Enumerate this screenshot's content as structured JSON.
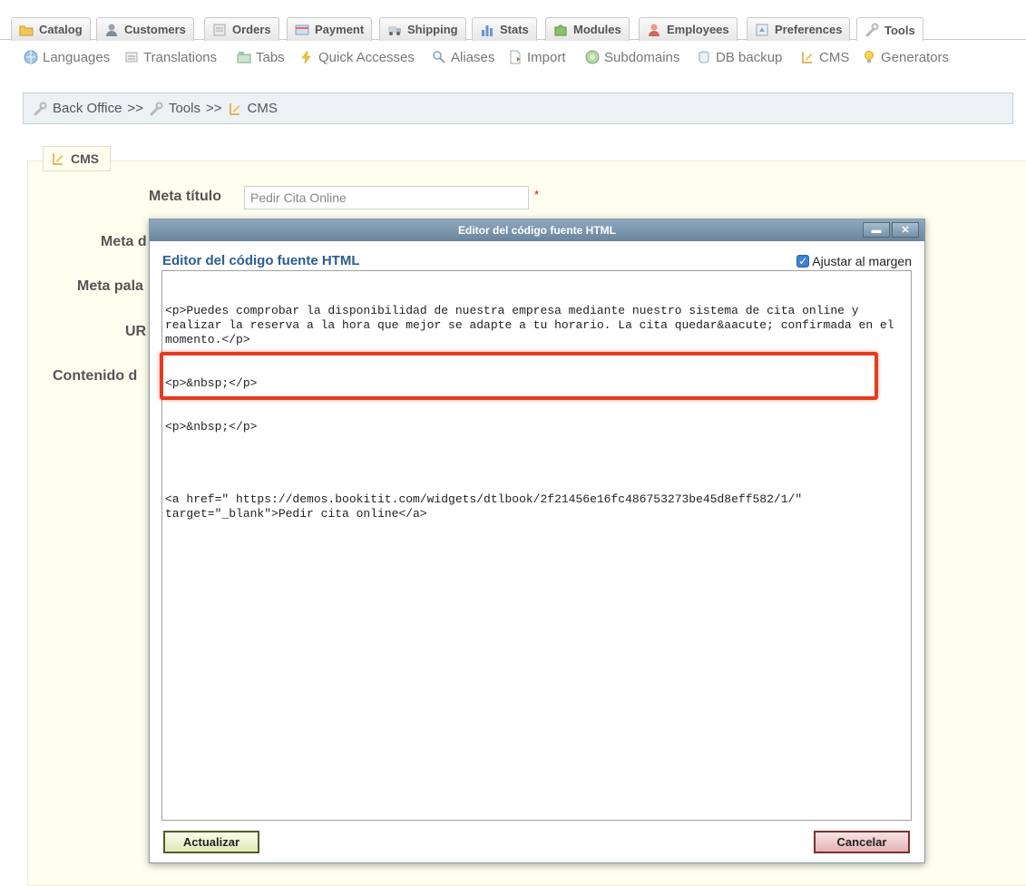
{
  "tabs": [
    {
      "label": "Catalog",
      "icon": "folder-icon"
    },
    {
      "label": "Customers",
      "icon": "user-icon"
    },
    {
      "label": "Orders",
      "icon": "orders-icon"
    },
    {
      "label": "Payment",
      "icon": "payment-icon"
    },
    {
      "label": "Shipping",
      "icon": "truck-icon"
    },
    {
      "label": "Stats",
      "icon": "bar-chart-icon"
    },
    {
      "label": "Modules",
      "icon": "puzzle-icon"
    },
    {
      "label": "Employees",
      "icon": "employee-icon"
    },
    {
      "label": "Preferences",
      "icon": "preferences-icon"
    },
    {
      "label": "Tools",
      "icon": "wrench-icon"
    }
  ],
  "subnav": [
    {
      "label": "Languages",
      "icon": "globe-icon"
    },
    {
      "label": "Translations",
      "icon": "translations-icon"
    },
    {
      "label": "Tabs",
      "icon": "tabs-icon"
    },
    {
      "label": "Quick Accesses",
      "icon": "lightning-icon"
    },
    {
      "label": "Aliases",
      "icon": "magnifier-icon"
    },
    {
      "label": "Import",
      "icon": "import-icon"
    },
    {
      "label": "Subdomains",
      "icon": "subdomains-icon"
    },
    {
      "label": "DB backup",
      "icon": "database-icon"
    },
    {
      "label": "CMS",
      "icon": "cms-icon"
    },
    {
      "label": "Generators",
      "icon": "bulb-icon"
    }
  ],
  "breadcrumb": {
    "root": "Back Office",
    "sep": ">>",
    "tools": "Tools",
    "cms": "CMS"
  },
  "form": {
    "legend": "CMS",
    "meta_title_label": "Meta título",
    "meta_title_value": "Pedir Cita Online",
    "required_mark": "*",
    "meta_desc_label": "Meta d",
    "meta_keywords_label": "Meta pala",
    "url_label": "UR",
    "content_label": "Contenido d"
  },
  "modal": {
    "title": "Editor del código fuente HTML",
    "heading": "Editor del código fuente HTML",
    "minimize": "▬",
    "close": "✕",
    "wrap_label": "Ajustar al margen",
    "code_lines": [
      "<p>Puedes comprobar la disponibilidad de nuestra empresa mediante nuestro sistema de cita online y realizar la reserva a la hora que mejor se adapte a tu horario. La cita quedar&aacute; confirmada en el momento.</p>",
      "<p>&nbsp;</p>",
      "<p>&nbsp;</p>",
      "",
      "<a href=\" https://demos.bookitit.com/widgets/dtlbook/2f21456e16fc486753273be45d8eff582/1/\" target=\"_blank\">Pedir cita online</a>"
    ],
    "update_label": "Actualizar",
    "cancel_label": "Cancelar"
  },
  "colors": {
    "highlight": "#e53b1e",
    "title_link": "#2b5d93",
    "modal_bar": "#7a93aa"
  }
}
